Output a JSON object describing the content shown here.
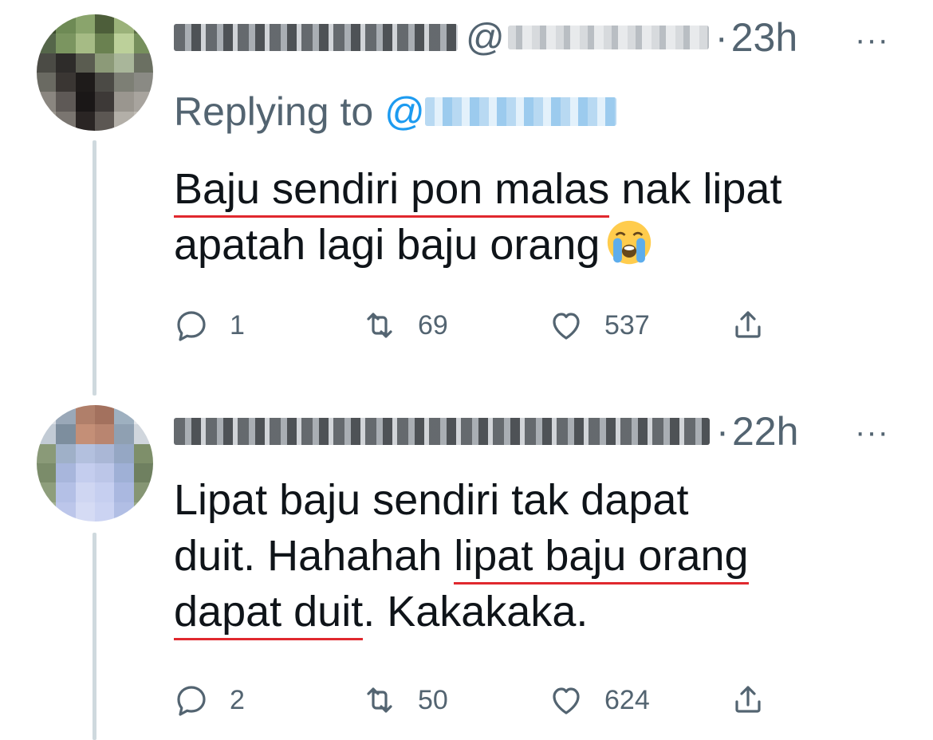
{
  "tweets": [
    {
      "username": "",
      "handle": "",
      "separator": "·",
      "time": "23h",
      "more_label": "···",
      "replying_label": "Replying to",
      "replying_prefix": "@",
      "lines": [
        {
          "underlined": "Baju sendiri pon malas",
          "rest": " nak lipat"
        },
        {
          "text": "apatah lagi baju orang"
        }
      ],
      "emoji": "loudly-crying-face",
      "counts": {
        "reply": "1",
        "retweet": "69",
        "like": "537"
      }
    },
    {
      "username": "",
      "separator": "·",
      "time": "22h",
      "more_label": "···",
      "lines": [
        {
          "text": "Lipat baju sendiri tak dapat"
        },
        {
          "pre": "duit. Hahahah ",
          "underlined": "lipat baju orang"
        },
        {
          "underlined": "dapat duit",
          "rest": ". Kakakaka."
        }
      ],
      "counts": {
        "reply": "2",
        "retweet": "50",
        "like": "624"
      }
    }
  ],
  "icons": {
    "reply": "reply-icon",
    "retweet": "retweet-icon",
    "like": "heart-icon",
    "share": "share-icon"
  },
  "colors": {
    "text": "#0f1419",
    "secondary": "#536471",
    "link": "#1d9bf0",
    "underline": "#e0282e",
    "thread_line": "#cfd9de"
  }
}
